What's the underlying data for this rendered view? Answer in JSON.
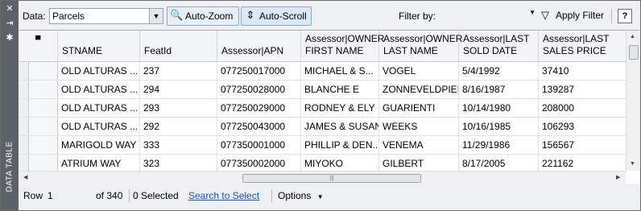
{
  "side": {
    "label": "DATA TABLE",
    "icons": [
      "close-icon",
      "auto-hide-icon",
      "settings-icon"
    ]
  },
  "toolbar": {
    "data_label": "Data:",
    "data_value": "Parcels",
    "auto_zoom": "Auto-Zoom",
    "auto_scroll": "Auto-Scroll",
    "filter_by_label": "Filter by:",
    "filter_value": "",
    "apply_filter": "Apply Filter",
    "help": "?"
  },
  "table": {
    "columns": [
      "STNAME",
      "FeatId",
      "Assessor|APN",
      "Assessor|OWNER\nFIRST NAME",
      "Assessor|OWNER\nLAST NAME",
      "Assessor|LAST\nSOLD DATE",
      "Assessor|LAST\nSALES PRICE"
    ],
    "rows": [
      [
        "OLD ALTURAS ...",
        "237",
        "077250017000",
        "MICHAEL & S...",
        "VOGEL",
        "5/4/1992",
        "37410"
      ],
      [
        "OLD ALTURAS ...",
        "294",
        "077250028000",
        "BLANCHE E",
        "ZONNEVELDPIEK",
        "8/16/1987",
        "139287"
      ],
      [
        "OLD ALTURAS ...",
        "293",
        "077250029000",
        "RODNEY & ELY",
        "GUARIENTI",
        "10/14/1980",
        "208000"
      ],
      [
        "OLD ALTURAS ...",
        "292",
        "077250043000",
        "JAMES & SUSAN",
        "WEEKS",
        "10/16/1985",
        "106293"
      ],
      [
        "MARIGOLD WAY",
        "333",
        "077350001000",
        "PHILLIP & DEN...",
        "VENEMA",
        "11/29/1986",
        "156567"
      ],
      [
        "ATRIUM WAY",
        "323",
        "077350002000",
        "MIYOKO",
        "GILBERT",
        "8/17/2005",
        "221162"
      ]
    ],
    "hscroll_grip": "|||"
  },
  "status": {
    "row_label": "Row",
    "row_value": "1",
    "of_count": "of 340",
    "selected": "0 Selected",
    "search_link": "Search to Select",
    "options": "Options"
  }
}
